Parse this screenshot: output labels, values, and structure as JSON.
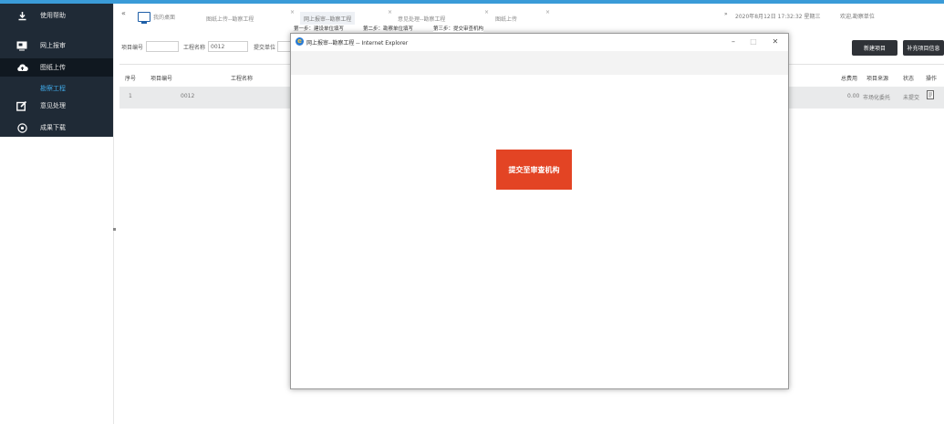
{
  "sidebar": {
    "items": [
      {
        "label": "使用帮助",
        "icon": "download-icon"
      },
      {
        "label": "网上报审",
        "icon": "monitor-icon"
      },
      {
        "label": "图纸上传",
        "icon": "cloud-upload-icon"
      },
      {
        "label": "意见处理",
        "icon": "edit-icon"
      },
      {
        "label": "成果下载",
        "icon": "circle-plus-icon"
      }
    ],
    "sub_item": "勘察工程"
  },
  "tabs": {
    "home": "我的桌面",
    "items": [
      "图纸上传--勘察工程",
      "网上报审--勘察工程",
      "意见处理--勘察工程",
      "图纸上传"
    ]
  },
  "header": {
    "datetime": "2020年8月12日 17:32:32 星期三",
    "welcome": "欢迎,勘察单位"
  },
  "filter": {
    "project_no_label": "项目编号",
    "project_no_value": "",
    "project_name_label": "工程名称",
    "project_name_value": "0012",
    "submit_unit_label": "提交单位",
    "submit_unit_value": ""
  },
  "actions": {
    "new_project": "新建项目",
    "supplement": "补充项目信息"
  },
  "table": {
    "headers": [
      "序号",
      "项目编号",
      "工程名称",
      "总费用",
      "项目来源",
      "状态",
      "操作"
    ],
    "rows": [
      {
        "index": "1",
        "project_no": "",
        "name": "0012",
        "fee": "0.00",
        "source": "市场化委托",
        "status": "未提交"
      }
    ]
  },
  "dialog": {
    "title": "网上报审--勘察工程 -- Internet Explorer",
    "steps": [
      "第一步：建设单位填写",
      "第二步：勘察单位填写",
      "第三步：提交审查机构"
    ],
    "submit_label": "提交至审查机构"
  },
  "colors": {
    "sidebar_bg": "#1f2a36",
    "accent": "#3a9bd8",
    "submit": "#e34424",
    "dark_button": "#2f3237"
  }
}
